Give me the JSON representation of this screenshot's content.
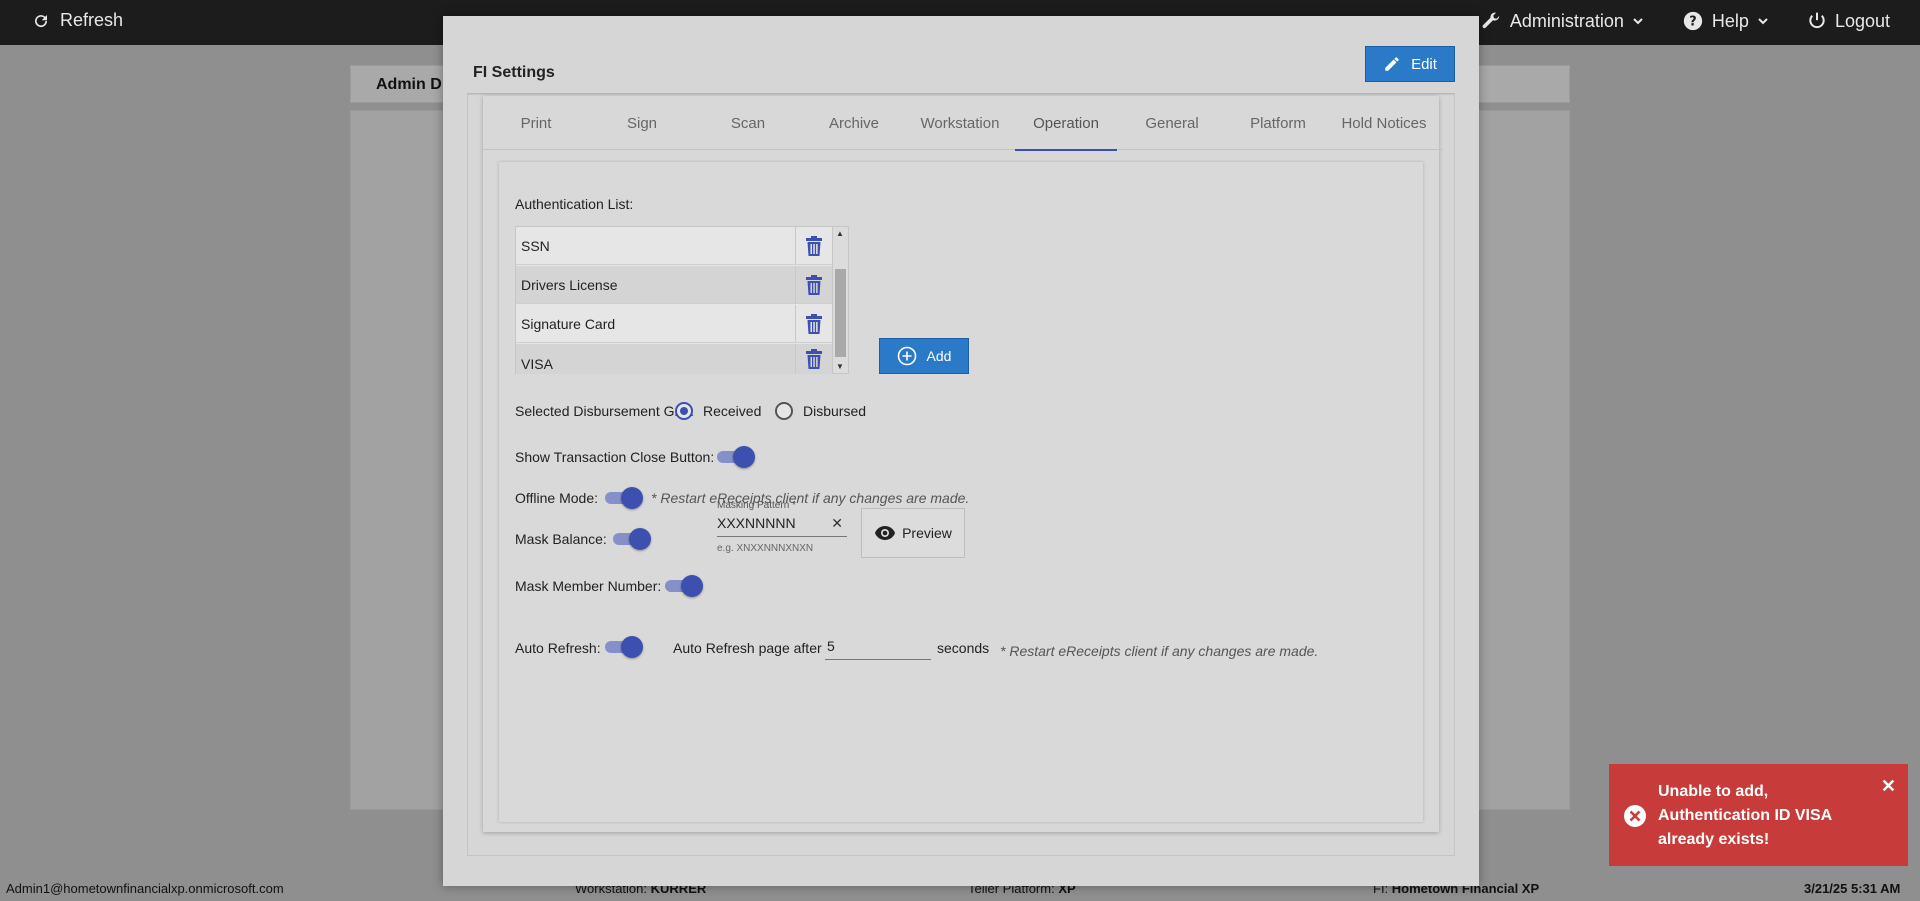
{
  "topbar": {
    "refresh_label": "Refresh",
    "admin_label": "Administration",
    "help_label": "Help",
    "logout_label": "Logout"
  },
  "background": {
    "tab_label": "Admin D"
  },
  "footer": {
    "user": "Admin1@hometownfinancialxp.onmicrosoft.com",
    "workstation_label": "Workstation:",
    "workstation_value": "KURRER",
    "teller_label": "Teller Platform:",
    "teller_value": "XP",
    "fi_label": "FI:",
    "fi_value": "Hometown Financial XP",
    "datetime": "3/21/25 5:31 AM"
  },
  "modal": {
    "title": "FI Settings",
    "edit_label": "Edit",
    "tabs": [
      {
        "label": "Print"
      },
      {
        "label": "Sign"
      },
      {
        "label": "Scan"
      },
      {
        "label": "Archive"
      },
      {
        "label": "Workstation"
      },
      {
        "label": "Operation"
      },
      {
        "label": "General"
      },
      {
        "label": "Platform"
      },
      {
        "label": "Hold Notices"
      }
    ],
    "active_tab": "Operation"
  },
  "operation": {
    "auth_list_label": "Authentication List:",
    "auth_items": [
      {
        "name": "SSN"
      },
      {
        "name": "Drivers License"
      },
      {
        "name": "Signature Card"
      },
      {
        "name": "VISA"
      }
    ],
    "add_label": "Add",
    "disbursement_label": "Selected Disbursement Grid:",
    "received_label": "Received",
    "disbursed_label": "Disbursed",
    "selected_grid": "Received",
    "close_button_label": "Show Transaction Close Button:",
    "offline_label": "Offline Mode:",
    "restart_note": "* Restart eReceipts client if any changes are made.",
    "mask_balance_label": "Mask Balance:",
    "mask_member_label": "Mask Member Number:",
    "masking_pattern_label": "Masking Pattern *",
    "masking_pattern_value": "XXXNNNNN",
    "masking_hint": "e.g. XNXXNNNXNXN",
    "preview_label": "Preview",
    "auto_refresh_label": "Auto Refresh:",
    "auto_refresh_text": "Auto Refresh page after",
    "auto_refresh_value": "5",
    "seconds_label": "seconds",
    "toggles": {
      "close_button": true,
      "offline_mode": true,
      "mask_balance": true,
      "mask_member": true,
      "auto_refresh": true
    }
  },
  "toast": {
    "message": "Unable to add, Authentication ID VISA already exists!"
  },
  "colors": {
    "accent": "#3d50b0",
    "button": "#2a7ac7",
    "error": "#c73b3b"
  }
}
